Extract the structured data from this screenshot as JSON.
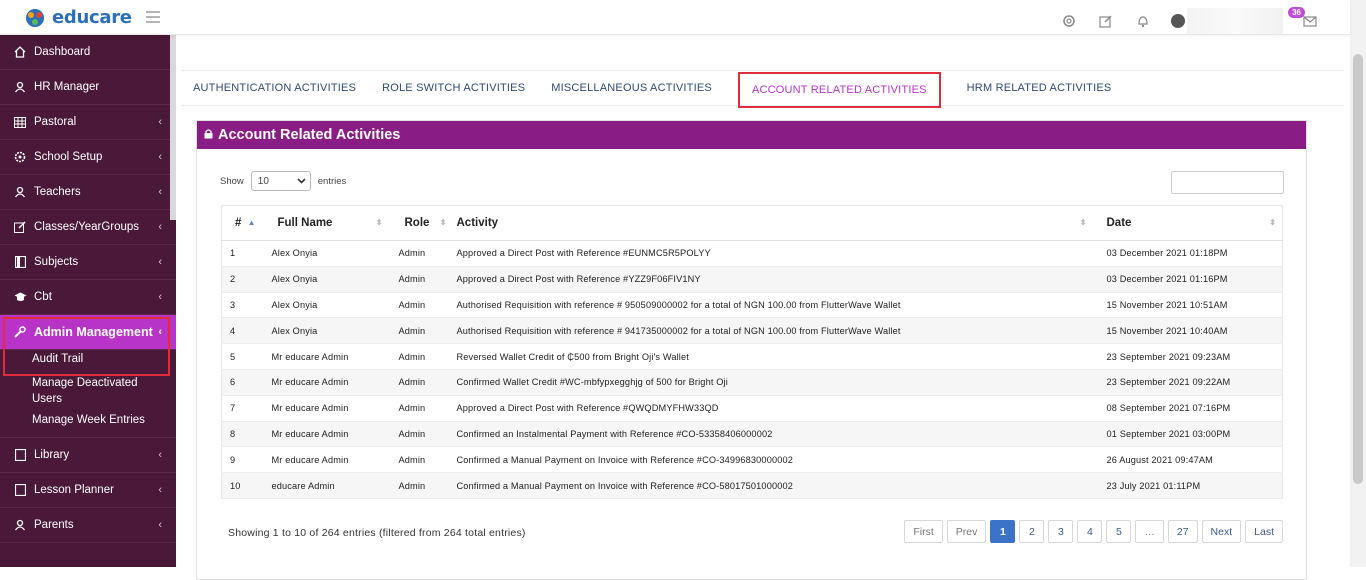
{
  "app": {
    "logo_text": "educare"
  },
  "header": {
    "notification_count": "36"
  },
  "sidebar": {
    "items": [
      {
        "label": "Dashboard",
        "chevron": ""
      },
      {
        "label": "HR Manager",
        "chevron": ""
      },
      {
        "label": "Pastoral",
        "chevron": "‹"
      },
      {
        "label": "School Setup",
        "chevron": "‹"
      },
      {
        "label": "Teachers",
        "chevron": "‹"
      },
      {
        "label": "Classes/YearGroups",
        "chevron": "‹"
      },
      {
        "label": "Subjects",
        "chevron": "‹"
      },
      {
        "label": "Cbt",
        "chevron": "‹"
      }
    ],
    "admin": {
      "label": "Admin Management",
      "chevron": "‹"
    },
    "admin_sub": [
      "Audit Trail",
      "Manage Deactivated Users",
      "Manage Week Entries"
    ],
    "items_after": [
      {
        "label": "Library",
        "chevron": "‹"
      },
      {
        "label": "Lesson Planner",
        "chevron": "‹"
      },
      {
        "label": "Parents",
        "chevron": "‹"
      }
    ]
  },
  "tabs": [
    "AUTHENTICATION ACTIVITIES",
    "ROLE SWITCH ACTIVITIES",
    "MISCELLANEOUS ACTIVITIES",
    "ACCOUNT RELATED ACTIVITIES",
    "HRM RELATED ACTIVITIES"
  ],
  "card": {
    "title": "Account Related Activities",
    "show_label": "Show",
    "entries_label": "entries",
    "page_length": "10"
  },
  "table": {
    "headers": [
      "#",
      "Full Name",
      "Role",
      "Activity",
      "Date"
    ],
    "rows": [
      [
        "1",
        "Alex Onyia",
        "Admin",
        "Approved a Direct Post with Reference #EUNMC5R5POLYY",
        "03 December 2021 01:18PM"
      ],
      [
        "2",
        "Alex Onyia",
        "Admin",
        "Approved a Direct Post with Reference #YZZ9F06FIV1NY",
        "03 December 2021 01:16PM"
      ],
      [
        "3",
        "Alex Onyia",
        "Admin",
        "Authorised Requisition with reference # 950509000002 for a total of NGN 100.00 from FlutterWave Wallet",
        "15 November 2021 10:51AM"
      ],
      [
        "4",
        "Alex Onyia",
        "Admin",
        "Authorised Requisition with reference # 941735000002 for a total of NGN 100.00 from FlutterWave Wallet",
        "15 November 2021 10:40AM"
      ],
      [
        "5",
        "Mr educare Admin",
        "Admin",
        "Reversed Wallet Credit of ₵500 from Bright Oji's Wallet",
        "23 September 2021 09:23AM"
      ],
      [
        "6",
        "Mr educare Admin",
        "Admin",
        "Confirmed Wallet Credit #WC-mbfypxegghjg of 500 for Bright Oji",
        "23 September 2021 09:22AM"
      ],
      [
        "7",
        "Mr educare Admin",
        "Admin",
        "Approved a Direct Post with Reference #QWQDMYFHW33QD",
        "08 September 2021 07:16PM"
      ],
      [
        "8",
        "Mr educare Admin",
        "Admin",
        "Confirmed an Instalmental Payment with Reference #CO-53358406000002",
        "01 September 2021 03:00PM"
      ],
      [
        "9",
        "Mr educare Admin",
        "Admin",
        "Confirmed a Manual Payment on Invoice with Reference #CO-34996830000002",
        "26 August 2021 09:47AM"
      ],
      [
        "10",
        "educare Admin",
        "Admin",
        "Confirmed a Manual Payment on Invoice with Reference #CO-58017501000002",
        "23 July 2021 01:11PM"
      ]
    ]
  },
  "footer": {
    "info": "Showing 1 to 10 of 264 entries (filtered from 264 total entries)",
    "pages": [
      "First",
      "Prev",
      "1",
      "2",
      "3",
      "4",
      "5",
      "…",
      "27",
      "Next",
      "Last"
    ]
  },
  "colors": {
    "sidebar_bg": "#4a1838",
    "accent": "#b834c8",
    "card_header": "#8a1c86",
    "highlight": "#e02d3d"
  }
}
